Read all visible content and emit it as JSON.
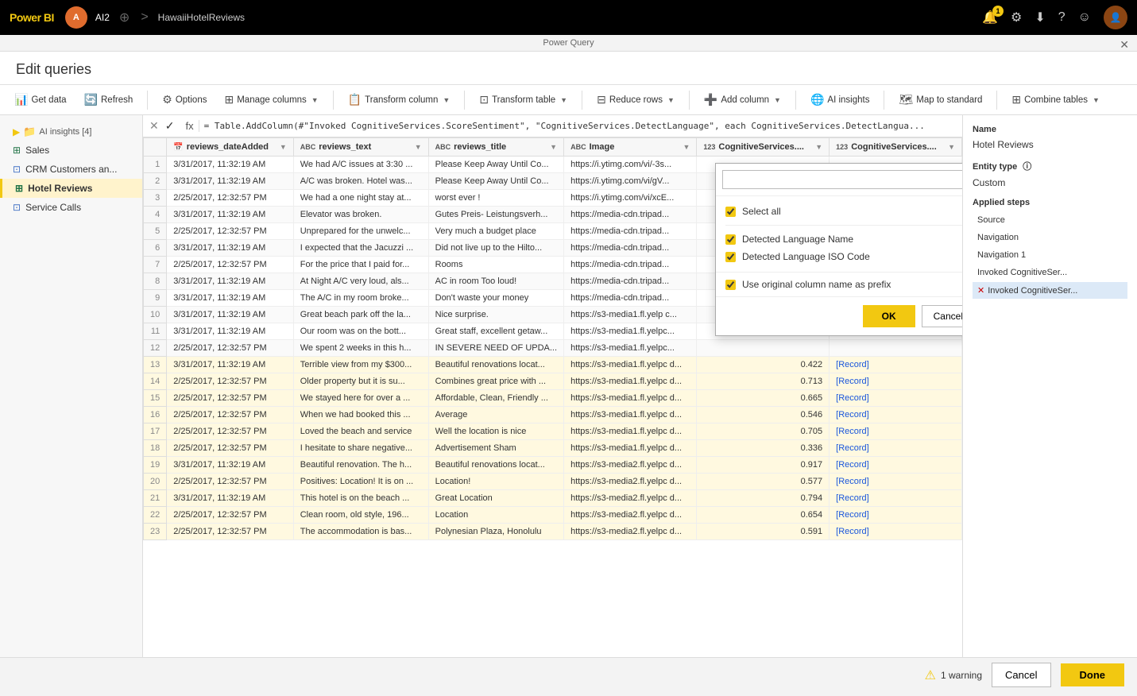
{
  "topbar": {
    "logo": "Power BI",
    "avatar_initial": "A",
    "username": "AI2",
    "breadcrumb_sep1": "⊕",
    "breadcrumb_arrow": ">",
    "breadcrumb_item": "HawaiiHotelReviews",
    "notification_count": "1"
  },
  "pq_title": "Power Query",
  "eq_header": "Edit queries",
  "toolbar": {
    "get_data": "Get data",
    "refresh": "Refresh",
    "options": "Options",
    "manage_columns": "Manage columns",
    "transform_column": "Transform column",
    "transform_table": "Transform table",
    "reduce_rows": "Reduce rows",
    "add_column": "Add column",
    "ai_insights": "AI insights",
    "map_to_standard": "Map to standard",
    "combine_tables": "Combine tables"
  },
  "sidebar": {
    "group_label": "AI insights [4]",
    "items": [
      {
        "label": "Sales",
        "type": "table"
      },
      {
        "label": "CRM Customers an...",
        "type": "query"
      },
      {
        "label": "Hotel Reviews",
        "type": "table",
        "active": true
      },
      {
        "label": "Service Calls",
        "type": "query"
      }
    ]
  },
  "formula_bar": {
    "formula": "= Table.AddColumn(#\"Invoked CognitiveServices.ScoreSentiment\", \"CognitiveServices.DetectLanguage\", each CognitiveServices.DetectLangua..."
  },
  "table": {
    "columns": [
      {
        "label": "reviews_dateAdded",
        "icon": "📅"
      },
      {
        "label": "reviews_text",
        "icon": "ABC"
      },
      {
        "label": "reviews_title",
        "icon": "ABC"
      },
      {
        "label": "Image",
        "icon": "ABC"
      },
      {
        "label": "CognitiveServices....",
        "icon": "123"
      },
      {
        "label": "CognitiveServices....",
        "icon": "123"
      }
    ],
    "rows": [
      {
        "num": 1,
        "date": "3/31/2017, 11:32:19 AM",
        "text": "We had A/C issues at 3:30 ...",
        "title": "Please Keep Away Until Co...",
        "image": "https://i.ytimg.com/vi/-3s...",
        "score": "",
        "record": ""
      },
      {
        "num": 2,
        "date": "3/31/2017, 11:32:19 AM",
        "text": "A/C was broken. Hotel was...",
        "title": "Please Keep Away Until Co...",
        "image": "https://i.ytimg.com/vi/gV...",
        "score": "",
        "record": ""
      },
      {
        "num": 3,
        "date": "2/25/2017, 12:32:57 PM",
        "text": "We had a one night stay at...",
        "title": "worst ever !",
        "image": "https://i.ytimg.com/vi/xcE...",
        "score": "",
        "record": ""
      },
      {
        "num": 4,
        "date": "3/31/2017, 11:32:19 AM",
        "text": "Elevator was broken.",
        "title": "Gutes Preis- Leistungsverh...",
        "image": "https://media-cdn.tripad...",
        "score": "",
        "record": ""
      },
      {
        "num": 5,
        "date": "2/25/2017, 12:32:57 PM",
        "text": "Unprepared for the unwelc...",
        "title": "Very much a budget place",
        "image": "https://media-cdn.tripad...",
        "score": "",
        "record": ""
      },
      {
        "num": 6,
        "date": "3/31/2017, 11:32:19 AM",
        "text": "I expected that the Jacuzzi ...",
        "title": "Did not live up to the Hilto...",
        "image": "https://media-cdn.tripad...",
        "score": "",
        "record": ""
      },
      {
        "num": 7,
        "date": "2/25/2017, 12:32:57 PM",
        "text": "For the price that I paid for...",
        "title": "Rooms",
        "image": "https://media-cdn.tripad...",
        "score": "",
        "record": ""
      },
      {
        "num": 8,
        "date": "3/31/2017, 11:32:19 AM",
        "text": "At Night A/C very loud, als...",
        "title": "AC in room Too loud!",
        "image": "https://media-cdn.tripad...",
        "score": "",
        "record": ""
      },
      {
        "num": 9,
        "date": "3/31/2017, 11:32:19 AM",
        "text": "The A/C in my room broke...",
        "title": "Don't waste your money",
        "image": "https://media-cdn.tripad...",
        "score": "",
        "record": ""
      },
      {
        "num": 10,
        "date": "3/31/2017, 11:32:19 AM",
        "text": "Great beach park off the la...",
        "title": "Nice surprise.",
        "image": "https://s3-media1.fl.yelp c...",
        "score": "",
        "record": ""
      },
      {
        "num": 11,
        "date": "3/31/2017, 11:32:19 AM",
        "text": "Our room was on the bott...",
        "title": "Great staff, excellent getaw...",
        "image": "https://s3-media1.fl.yelpc...",
        "score": "",
        "record": ""
      },
      {
        "num": 12,
        "date": "2/25/2017, 12:32:57 PM",
        "text": "We spent 2 weeks in this h...",
        "title": "IN SEVERE NEED OF UPDA...",
        "image": "https://s3-media1.fl.yelpc...",
        "score": "",
        "record": ""
      },
      {
        "num": 13,
        "date": "3/31/2017, 11:32:19 AM",
        "text": "Terrible view from my $300...",
        "title": "Beautiful renovations locat...",
        "image": "https://s3-media1.fl.yelpc d...",
        "score": "0.422",
        "record": "[Record]",
        "highlighted": true
      },
      {
        "num": 14,
        "date": "2/25/2017, 12:32:57 PM",
        "text": "Older property but it is su...",
        "title": "Combines great price with ...",
        "image": "https://s3-media1.fl.yelpc d...",
        "score": "0.713",
        "record": "[Record]",
        "highlighted": true
      },
      {
        "num": 15,
        "date": "2/25/2017, 12:32:57 PM",
        "text": "We stayed here for over a ...",
        "title": "Affordable, Clean, Friendly ...",
        "image": "https://s3-media1.fl.yelpc d...",
        "score": "0.665",
        "record": "[Record]",
        "highlighted": true
      },
      {
        "num": 16,
        "date": "2/25/2017, 12:32:57 PM",
        "text": "When we had booked this ...",
        "title": "Average",
        "image": "https://s3-media1.fl.yelpc d...",
        "score": "0.546",
        "record": "[Record]",
        "highlighted": true
      },
      {
        "num": 17,
        "date": "2/25/2017, 12:32:57 PM",
        "text": "Loved the beach and service",
        "title": "Well the location is nice",
        "image": "https://s3-media1.fl.yelpc d...",
        "score": "0.705",
        "record": "[Record]",
        "highlighted": true
      },
      {
        "num": 18,
        "date": "2/25/2017, 12:32:57 PM",
        "text": "I hesitate to share negative...",
        "title": "Advertisement Sham",
        "image": "https://s3-media1.fl.yelpc d...",
        "score": "0.336",
        "record": "[Record]",
        "highlighted": true
      },
      {
        "num": 19,
        "date": "3/31/2017, 11:32:19 AM",
        "text": "Beautiful renovation. The h...",
        "title": "Beautiful renovations locat...",
        "image": "https://s3-media2.fl.yelpc d...",
        "score": "0.917",
        "record": "[Record]",
        "highlighted": true
      },
      {
        "num": 20,
        "date": "2/25/2017, 12:32:57 PM",
        "text": "Positives: Location! It is on ...",
        "title": "Location!",
        "image": "https://s3-media2.fl.yelpc d...",
        "score": "0.577",
        "record": "[Record]",
        "highlighted": true
      },
      {
        "num": 21,
        "date": "3/31/2017, 11:32:19 AM",
        "text": "This hotel is on the beach ...",
        "title": "Great Location",
        "image": "https://s3-media2.fl.yelpc d...",
        "score": "0.794",
        "record": "[Record]",
        "highlighted": true
      },
      {
        "num": 22,
        "date": "2/25/2017, 12:32:57 PM",
        "text": "Clean room, old style, 196...",
        "title": "Location",
        "image": "https://s3-media2.fl.yelpc d...",
        "score": "0.654",
        "record": "[Record]",
        "highlighted": true
      },
      {
        "num": 23,
        "date": "2/25/2017, 12:32:57 PM",
        "text": "The accommodation is bas...",
        "title": "Polynesian Plaza, Honolulu",
        "image": "https://s3-media2.fl.yelpc d...",
        "score": "0.591",
        "record": "[Record]",
        "highlighted": true
      }
    ]
  },
  "popup": {
    "search_placeholder": "",
    "select_all_label": "Select all",
    "select_all_checked": true,
    "option1_label": "Detected Language Name",
    "option1_checked": true,
    "option2_label": "Detected Language ISO Code",
    "option2_checked": true,
    "prefix_label": "Use original column name as prefix",
    "prefix_checked": true,
    "ok_label": "OK",
    "cancel_label": "Cancel"
  },
  "right_panel": {
    "name_label": "Name",
    "name_value": "Hotel Reviews",
    "entity_type_label": "Entity type",
    "entity_type_info": "ⓘ",
    "entity_type_value": "Custom",
    "steps_label": "Applied steps",
    "steps": [
      {
        "label": "Source",
        "active": false
      },
      {
        "label": "Navigation",
        "active": false
      },
      {
        "label": "Navigation 1",
        "active": false
      },
      {
        "label": "Invoked CognitiveSer...",
        "active": false
      },
      {
        "label": "Invoked CognitiveSer...",
        "active": true,
        "has_x": true
      }
    ]
  },
  "bottom": {
    "warning_text": "1 warning",
    "cancel_label": "Cancel",
    "done_label": "Done"
  }
}
